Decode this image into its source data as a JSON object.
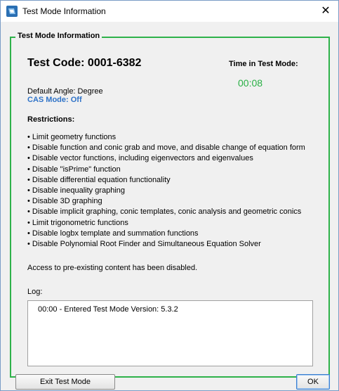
{
  "window": {
    "title": "Test Mode Information",
    "close_label": "✕"
  },
  "group": {
    "legend": "Test Mode Information"
  },
  "test": {
    "code_label": "Test Code: 0001-6382",
    "time_label": "Time in Test Mode:",
    "time_value": "00:08",
    "default_angle": "Default Angle: Degree",
    "cas_mode": "CAS Mode: Off"
  },
  "restrictions": {
    "title": "Restrictions:",
    "items": [
      "Limit geometry functions",
      "Disable function and conic grab and move, and disable change of equation form",
      "Disable vector functions, including eigenvectors and eigenvalues",
      "Disable \"isPrime\" function",
      "Disable differential equation functionality",
      "Disable inequality graphing",
      "Disable 3D graphing",
      "Disable implicit graphing, conic templates, conic analysis and geometric conics",
      "Limit trigonometric functions",
      "Disable logbx template and summation functions",
      "Disable Polynomial Root Finder and Simultaneous Equation Solver"
    ]
  },
  "access_note": "Access to pre-existing content has been disabled.",
  "log": {
    "label": "Log:",
    "entries": [
      "00:00 - Entered Test Mode Version: 5.3.2"
    ]
  },
  "buttons": {
    "exit_label": "Exit Test Mode",
    "ok_label": "OK"
  },
  "colors": {
    "group_border": "#2eb24a",
    "time_value": "#29b045",
    "cas_mode": "#2f73c8"
  },
  "icons": {
    "app_icon": "ti-nspire-app-icon",
    "close": "close-icon"
  }
}
